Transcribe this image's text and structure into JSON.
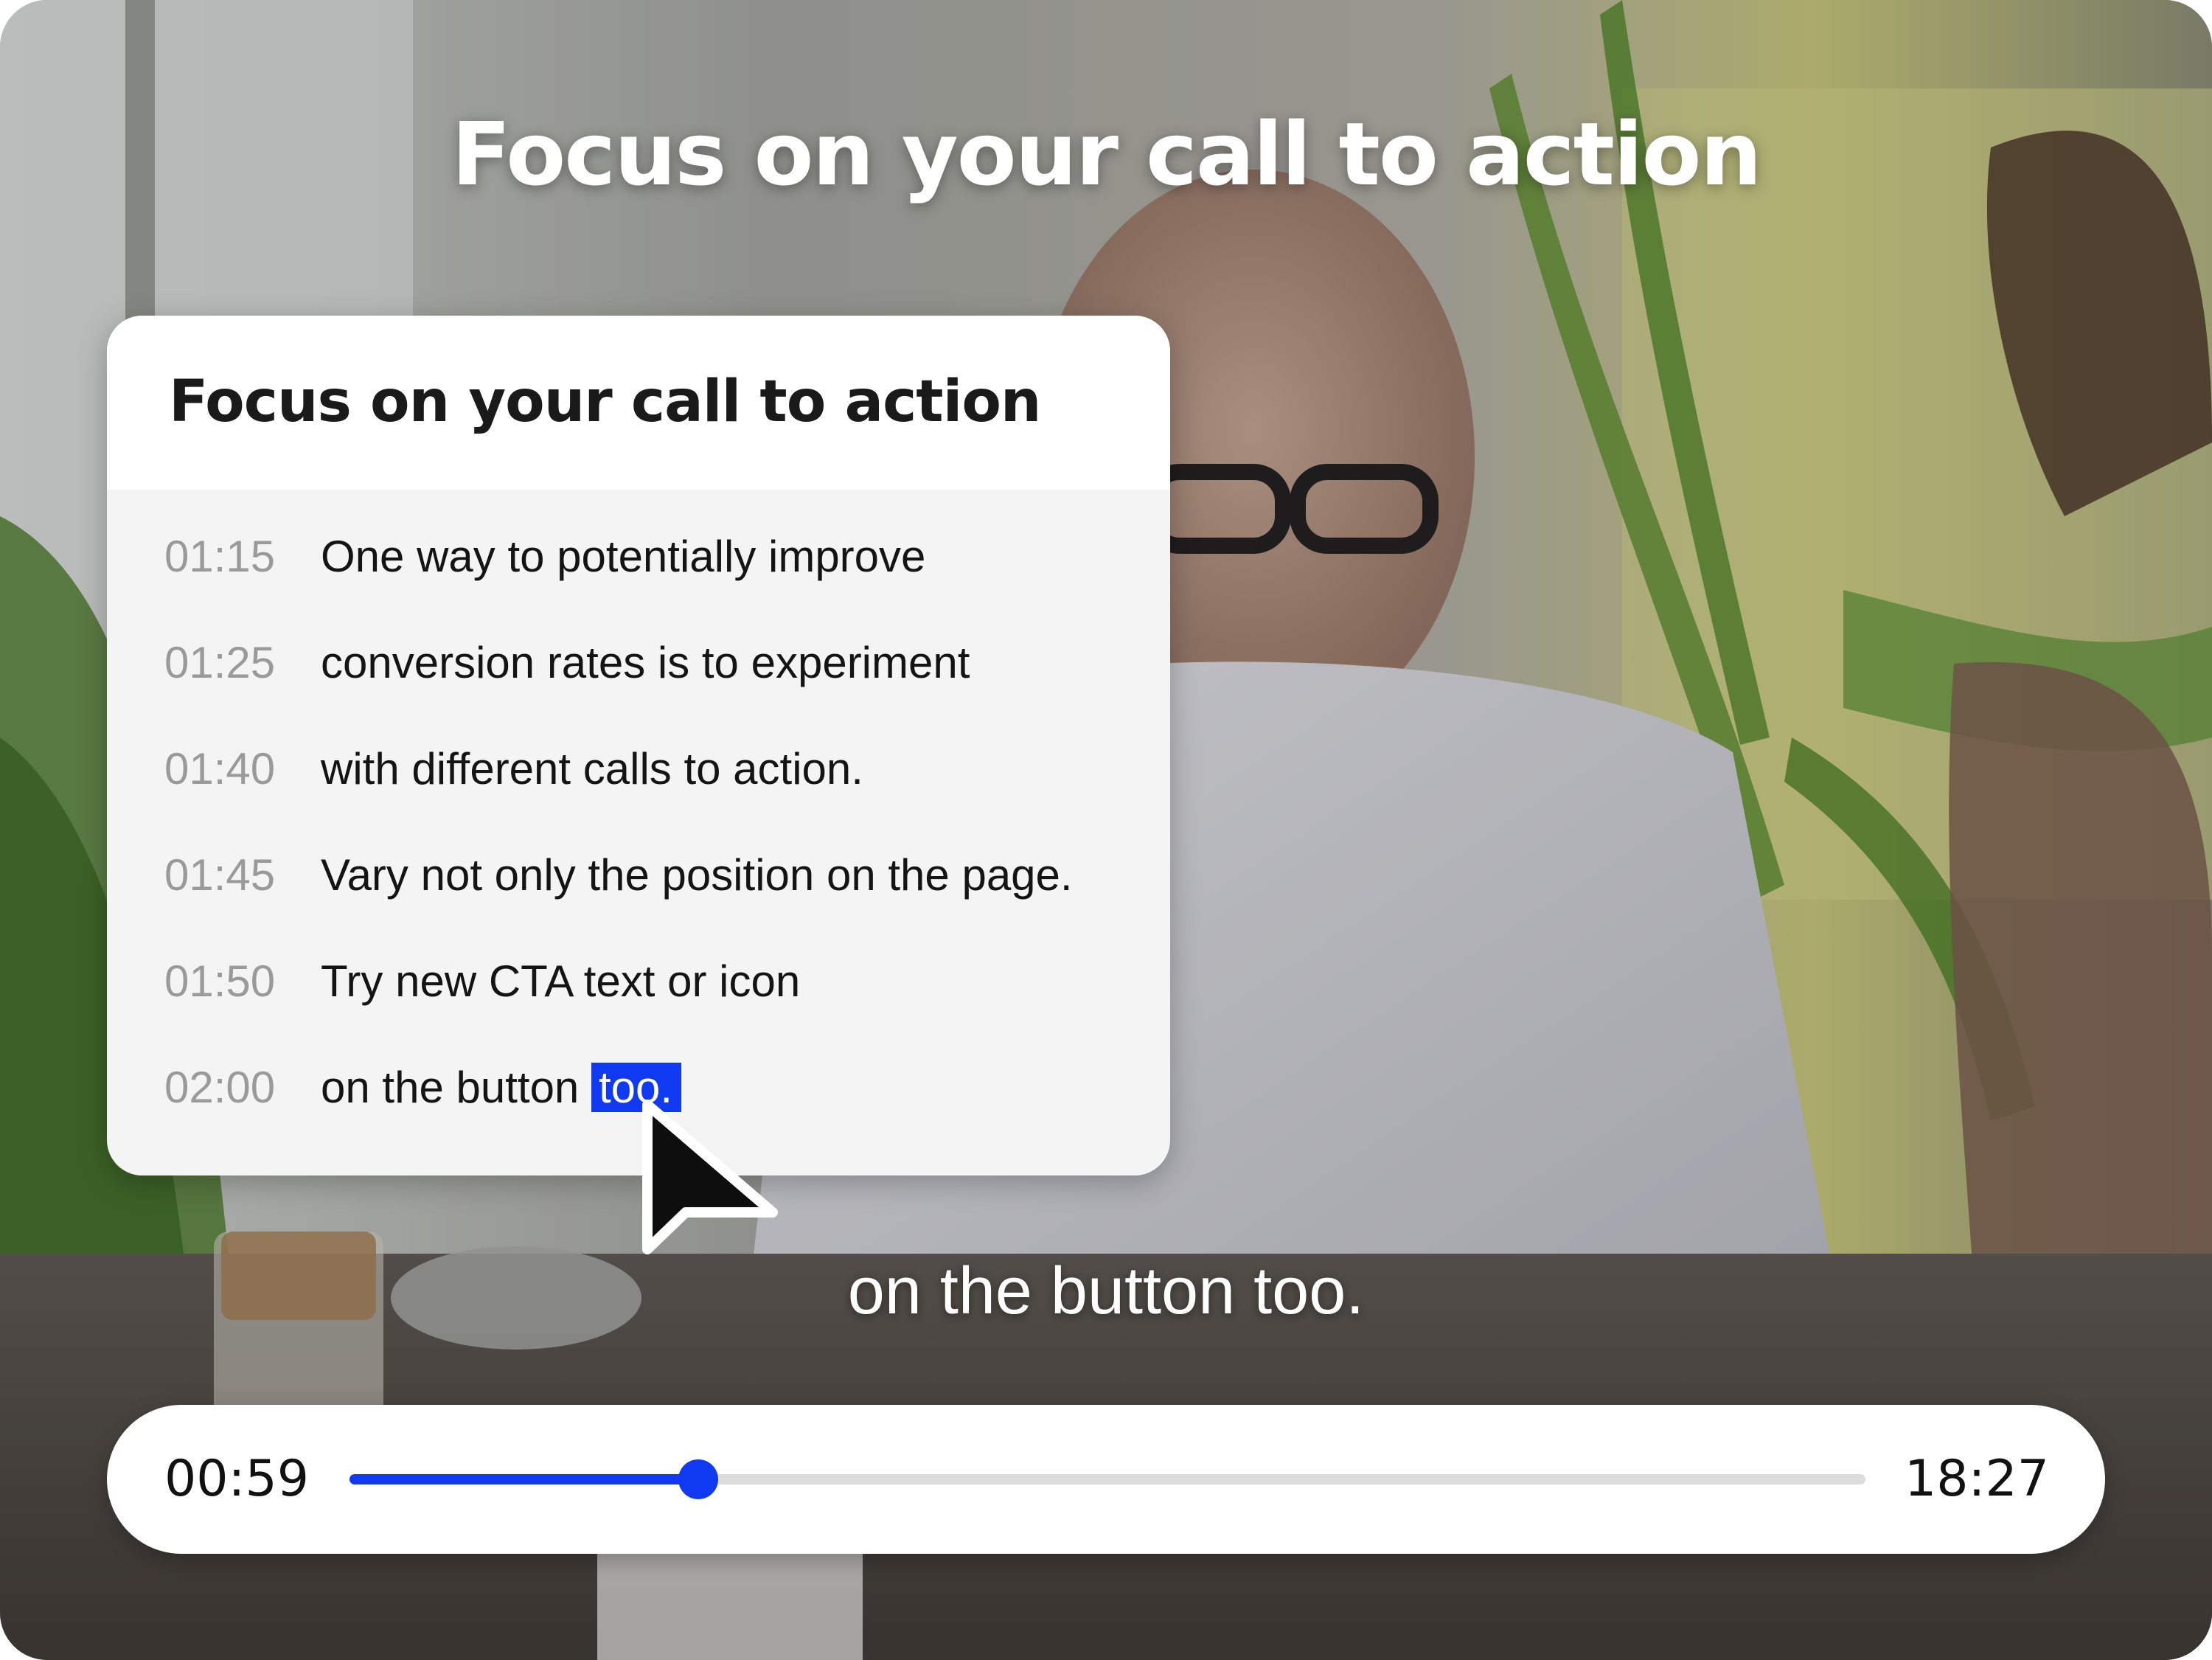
{
  "video": {
    "title": "Focus on your call to action",
    "caption": "on the button too."
  },
  "transcript": {
    "title": "Focus on your call to action",
    "lines": [
      {
        "time": "01:15",
        "text": "One way to potentially improve"
      },
      {
        "time": "01:25",
        "text": "conversion rates is to experiment"
      },
      {
        "time": "01:40",
        "text": "with different calls to action."
      },
      {
        "time": "01:45",
        "text": "Vary not only the position on the page."
      },
      {
        "time": "01:50",
        "text": "Try new CTA text or icon"
      },
      {
        "time": "02:00",
        "text": "on the button",
        "highlight": "too."
      }
    ]
  },
  "player": {
    "current_time": "00:59",
    "total_time": "18:27",
    "progress": 0.23
  },
  "colors": {
    "accent": "#1039f2",
    "track": "#dcdcdc"
  },
  "icons": {
    "cursor": "arrow-cursor-icon"
  }
}
